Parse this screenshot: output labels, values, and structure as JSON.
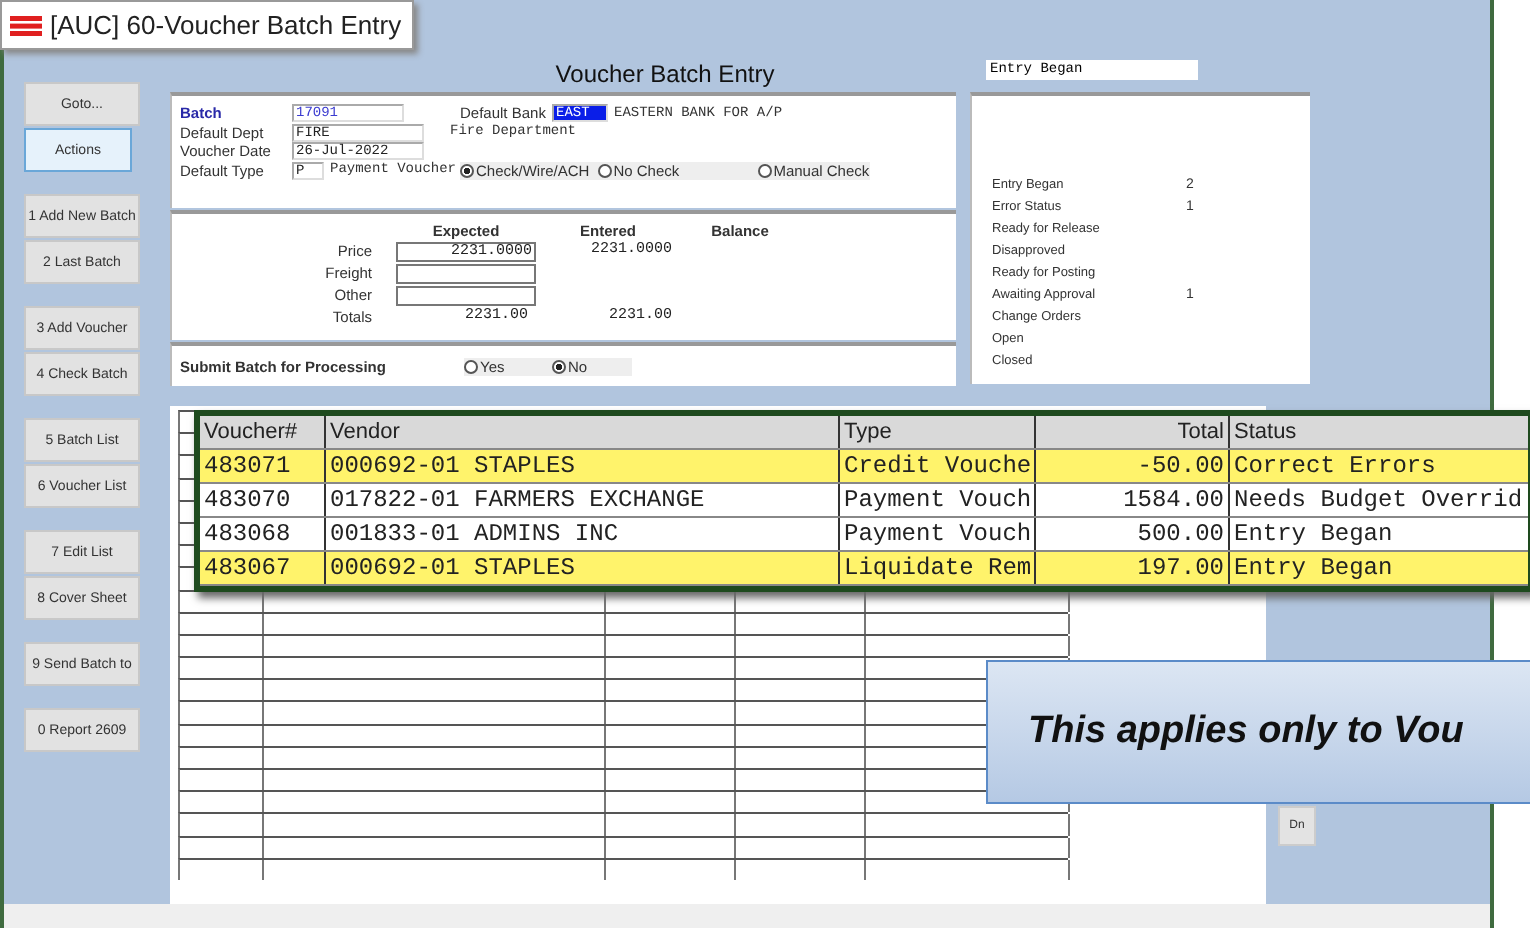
{
  "window": {
    "title": "[AUC] 60-Voucher Batch Entry"
  },
  "heading": "Voucher Batch Entry",
  "status_field": {
    "value": "Entry Began"
  },
  "sidebar": {
    "groups": [
      [
        {
          "label": "Goto...",
          "selected": false
        },
        {
          "label": "Actions",
          "selected": true
        }
      ],
      [
        {
          "label": "1 Add New Batch",
          "selected": false
        },
        {
          "label": "2 Last Batch",
          "selected": false
        }
      ],
      [
        {
          "label": "3 Add Voucher",
          "selected": false
        },
        {
          "label": "4 Check Batch",
          "selected": false
        }
      ],
      [
        {
          "label": "5 Batch List",
          "selected": false
        },
        {
          "label": "6 Voucher List",
          "selected": false
        }
      ],
      [
        {
          "label": "7 Edit List",
          "selected": false
        },
        {
          "label": "8 Cover Sheet",
          "selected": false
        }
      ],
      [
        {
          "label": "9 Send Batch to",
          "selected": false
        }
      ],
      [
        {
          "label": "0 Report 2609",
          "selected": false
        }
      ]
    ]
  },
  "batch": {
    "label": "Batch",
    "value": "17091"
  },
  "default_bank": {
    "label": "Default Bank",
    "value": "EAST",
    "description": "EASTERN BANK FOR A/P"
  },
  "default_dept": {
    "label": "Default Dept",
    "value": "FIRE",
    "description": "Fire Department"
  },
  "voucher_date": {
    "label": "Voucher Date",
    "value": "26-Jul-2022"
  },
  "default_type": {
    "label": "Default Type",
    "value": "P",
    "description": "Payment Voucher",
    "options": [
      {
        "label": "Check/Wire/ACH",
        "selected": true
      },
      {
        "label": "No Check",
        "selected": false
      },
      {
        "label": "Manual Check",
        "selected": false
      }
    ]
  },
  "totals": {
    "columns": [
      "Expected",
      "Entered",
      "Balance"
    ],
    "rows": [
      {
        "label": "Price",
        "kind": "input",
        "expected": "2231.0000",
        "entered": "2231.0000"
      },
      {
        "label": "Freight",
        "kind": "input"
      },
      {
        "label": "Other",
        "kind": "input"
      },
      {
        "label": "Totals",
        "kind": "text",
        "expected": "2231.00",
        "entered": "2231.00"
      }
    ]
  },
  "submit": {
    "label": "Submit Batch for Processing",
    "options": [
      {
        "label": "Yes",
        "selected": false
      },
      {
        "label": "No",
        "selected": true
      }
    ]
  },
  "status_counts": [
    {
      "label": "Entry Began",
      "count": "2"
    },
    {
      "label": "Error Status",
      "count": "1"
    },
    {
      "label": "Ready for Release"
    },
    {
      "label": "Disapproved"
    },
    {
      "label": "Ready for Posting"
    },
    {
      "label": "Awaiting Approval",
      "count": "1"
    },
    {
      "label": "Change Orders"
    },
    {
      "label": "Open"
    },
    {
      "label": "Closed"
    }
  ],
  "table": {
    "columns": [
      "Voucher#",
      "Vendor",
      "Type",
      "Total",
      "Status"
    ],
    "rows": [
      {
        "cells": [
          "483071",
          "000692-01 STAPLES",
          "Credit Vouche",
          "-50.00",
          "Correct Errors"
        ],
        "highlighted": true
      },
      {
        "cells": [
          "483070",
          "017822-01 FARMERS EXCHANGE",
          "Payment Vouch",
          "1584.00",
          "Needs Budget Overrid"
        ],
        "highlighted": false
      },
      {
        "cells": [
          "483068",
          "001833-01 ADMINS INC",
          "Payment Vouch",
          "500.00",
          "Entry Began"
        ],
        "highlighted": false
      },
      {
        "cells": [
          "483067",
          "000692-01 STAPLES",
          "Liquidate Rem",
          "197.00",
          "Entry Began"
        ],
        "highlighted": true
      }
    ]
  },
  "dn_button": "Dn",
  "callout": "This applies only to Vou"
}
